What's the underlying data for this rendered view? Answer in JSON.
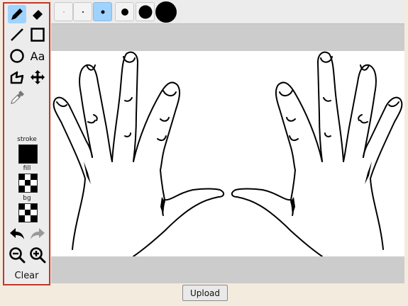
{
  "toolbar": {
    "tools": [
      {
        "name": "pencil-icon"
      },
      {
        "name": "eraser-icon"
      },
      {
        "name": "line-icon"
      },
      {
        "name": "rectangle-icon"
      },
      {
        "name": "ellipse-icon"
      },
      {
        "name": "text-icon",
        "text": "Aa"
      },
      {
        "name": "polygon-icon"
      },
      {
        "name": "move-icon"
      },
      {
        "name": "eyedropper-icon"
      }
    ],
    "stroke_label": "stroke",
    "fill_label": "fill",
    "bg_label": "bg",
    "stroke_color": "#000000",
    "clear_label": "Clear",
    "selected_tool": "pencil-icon"
  },
  "sizes": {
    "selected_index": 3,
    "options": [
      "size-1",
      "size-2",
      "size-3",
      "size-4",
      "size-5",
      "size-6"
    ]
  },
  "upload_label": "Upload",
  "colors": {
    "selected": "#9fd3ff",
    "frame": "#c0382b",
    "canvas_bg": "#cccccc"
  }
}
